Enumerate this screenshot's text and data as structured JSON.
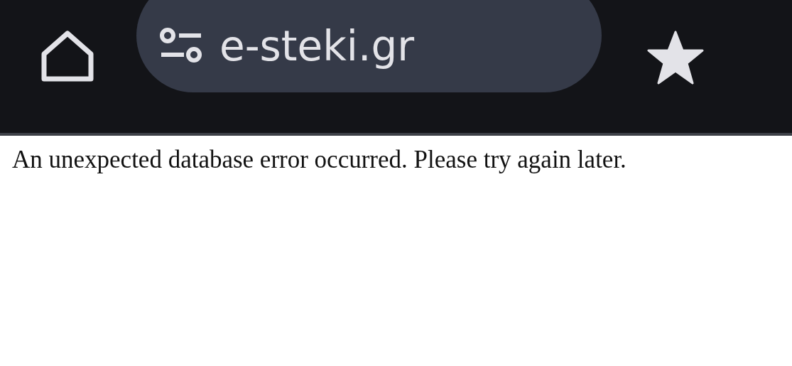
{
  "toolbar": {
    "url": "e-steki.gr",
    "bookmarked": true
  },
  "page": {
    "message": "An unexpected database error occurred. Please try again later."
  }
}
